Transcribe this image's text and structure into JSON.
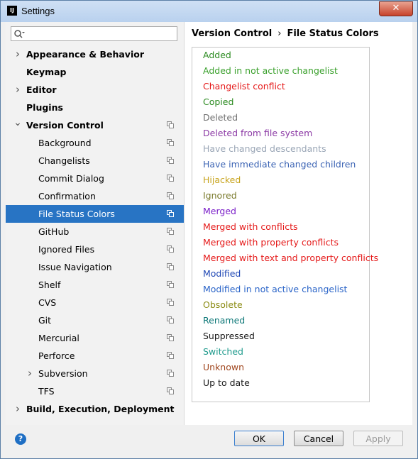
{
  "window": {
    "title": "Settings",
    "app_icon": "IJ",
    "close_label": "✕"
  },
  "search": {
    "placeholder": "",
    "value": ""
  },
  "tree": {
    "items": [
      {
        "label": "Appearance & Behavior",
        "level": 0,
        "arrow": "right",
        "selected": false,
        "copy_icon": false
      },
      {
        "label": "Keymap",
        "level": 0,
        "arrow": "",
        "selected": false,
        "copy_icon": false
      },
      {
        "label": "Editor",
        "level": 0,
        "arrow": "right",
        "selected": false,
        "copy_icon": false
      },
      {
        "label": "Plugins",
        "level": 0,
        "arrow": "",
        "selected": false,
        "copy_icon": false
      },
      {
        "label": "Version Control",
        "level": 0,
        "arrow": "down",
        "selected": false,
        "copy_icon": true
      },
      {
        "label": "Background",
        "level": 1,
        "arrow": "",
        "selected": false,
        "copy_icon": true
      },
      {
        "label": "Changelists",
        "level": 1,
        "arrow": "",
        "selected": false,
        "copy_icon": true
      },
      {
        "label": "Commit Dialog",
        "level": 1,
        "arrow": "",
        "selected": false,
        "copy_icon": true
      },
      {
        "label": "Confirmation",
        "level": 1,
        "arrow": "",
        "selected": false,
        "copy_icon": true
      },
      {
        "label": "File Status Colors",
        "level": 1,
        "arrow": "",
        "selected": true,
        "copy_icon": true
      },
      {
        "label": "GitHub",
        "level": 1,
        "arrow": "",
        "selected": false,
        "copy_icon": true
      },
      {
        "label": "Ignored Files",
        "level": 1,
        "arrow": "",
        "selected": false,
        "copy_icon": true
      },
      {
        "label": "Issue Navigation",
        "level": 1,
        "arrow": "",
        "selected": false,
        "copy_icon": true
      },
      {
        "label": "Shelf",
        "level": 1,
        "arrow": "",
        "selected": false,
        "copy_icon": true
      },
      {
        "label": "CVS",
        "level": 1,
        "arrow": "",
        "selected": false,
        "copy_icon": true
      },
      {
        "label": "Git",
        "level": 1,
        "arrow": "",
        "selected": false,
        "copy_icon": true
      },
      {
        "label": "Mercurial",
        "level": 1,
        "arrow": "",
        "selected": false,
        "copy_icon": true
      },
      {
        "label": "Perforce",
        "level": 1,
        "arrow": "",
        "selected": false,
        "copy_icon": true
      },
      {
        "label": "Subversion",
        "level": 1,
        "arrow": "right",
        "selected": false,
        "copy_icon": true
      },
      {
        "label": "TFS",
        "level": 1,
        "arrow": "",
        "selected": false,
        "copy_icon": true
      },
      {
        "label": "Build, Execution, Deployment",
        "level": 0,
        "arrow": "right",
        "selected": false,
        "copy_icon": false
      }
    ]
  },
  "breadcrumb": {
    "parent": "Version Control",
    "separator": "›",
    "current": "File Status Colors"
  },
  "file_status_colors": [
    {
      "label": "Added",
      "color": "#2a8a1f"
    },
    {
      "label": "Added in not active changelist",
      "color": "#3aa02c"
    },
    {
      "label": "Changelist conflict",
      "color": "#e51a1a"
    },
    {
      "label": "Copied",
      "color": "#2a8a1f"
    },
    {
      "label": "Deleted",
      "color": "#6e6e6e"
    },
    {
      "label": "Deleted from file system",
      "color": "#8c3aa5"
    },
    {
      "label": "Have changed descendants",
      "color": "#9aa6b6"
    },
    {
      "label": "Have immediate changed children",
      "color": "#3c64b4"
    },
    {
      "label": "Hijacked",
      "color": "#c8a41e"
    },
    {
      "label": "Ignored",
      "color": "#7a7a2c"
    },
    {
      "label": "Merged",
      "color": "#7a1ec8"
    },
    {
      "label": "Merged with conflicts",
      "color": "#e51a1a"
    },
    {
      "label": "Merged with property conflicts",
      "color": "#e51a1a"
    },
    {
      "label": "Merged with text and property conflicts",
      "color": "#e51a1a"
    },
    {
      "label": "Modified",
      "color": "#1e46b4"
    },
    {
      "label": "Modified in not active changelist",
      "color": "#2a64c8"
    },
    {
      "label": "Obsolete",
      "color": "#8c8c14"
    },
    {
      "label": "Renamed",
      "color": "#0e7878"
    },
    {
      "label": "Suppressed",
      "color": "#1a1a1a"
    },
    {
      "label": "Switched",
      "color": "#1e9a8c"
    },
    {
      "label": "Unknown",
      "color": "#a0461e"
    },
    {
      "label": "Up to date",
      "color": "#1a1a1a"
    }
  ],
  "buttons": {
    "help": "?",
    "ok": "OK",
    "cancel": "Cancel",
    "apply": "Apply"
  }
}
